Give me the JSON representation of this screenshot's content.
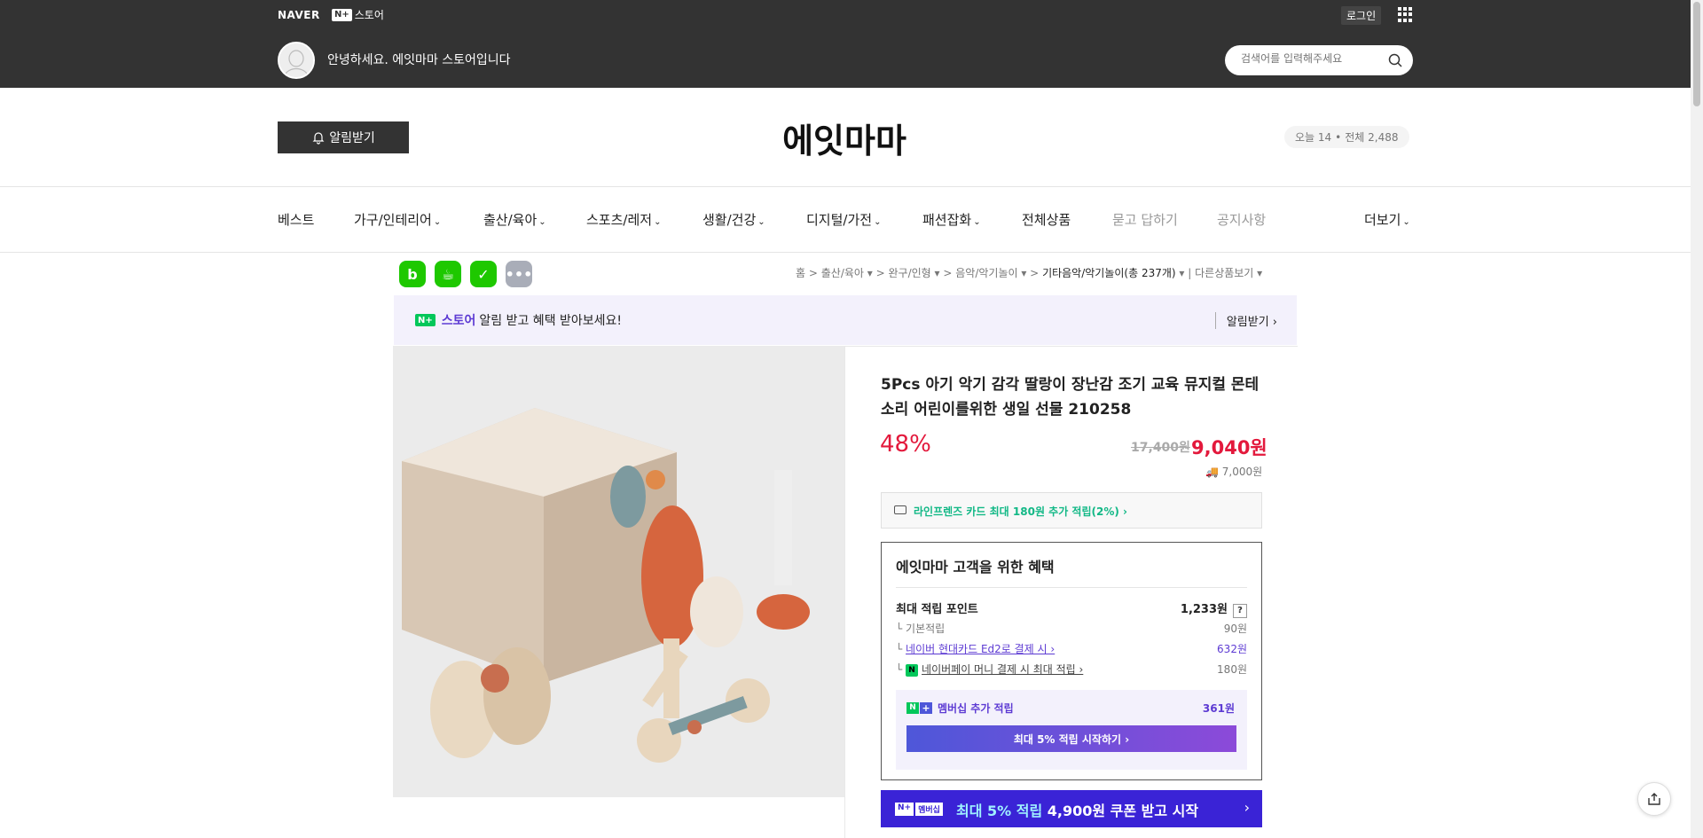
{
  "topbar": {
    "naver": "NAVER",
    "nplus_box": "N+",
    "nplus_store": "스토어",
    "login": "로그인",
    "greeting": "안녕하세요. 에잇마마 스토어입니다",
    "search_placeholder": "검색어를 입력해주세요"
  },
  "store": {
    "alert_label": "알림받기",
    "title": "에잇마마",
    "visit_today": "오늘 14",
    "visit_dot": "•",
    "visit_total": "전체 2,488"
  },
  "nav": {
    "items": [
      {
        "label": "베스트"
      },
      {
        "label": "가구/인테리어"
      },
      {
        "label": "출산/육아"
      },
      {
        "label": "스포츠/레저"
      },
      {
        "label": "생활/건강"
      },
      {
        "label": "디지털/가전"
      },
      {
        "label": "패션잡화"
      },
      {
        "label": "전체상품"
      },
      {
        "label": "묻고 답하기"
      },
      {
        "label": "공지사항"
      },
      {
        "label": "더보기"
      }
    ]
  },
  "breadcrumb": {
    "home": "홈",
    "c1": "출산/육아",
    "c2": "완구/인형",
    "c3": "음악/악기놀이",
    "c4": "기타음악/악기놀이(총 237개)",
    "other": "다른상품보기"
  },
  "banner": {
    "n_badge": "N+",
    "store": "스토어",
    "text": "알림 받고 혜택 받아보세요!",
    "right": "알림받기 ›"
  },
  "product": {
    "title": "5Pcs 아기 악기 감각 딸랑이 장난감 조기 교육 뮤지컬 몬테소리 어린이를위한 생일 선물 210258",
    "discount": "48%",
    "original_price": "17,400원",
    "price": "9,040원",
    "shipping": "7,000원",
    "card_promo": "라인프렌즈 카드 최대 180원 추가 적립(2%) ›"
  },
  "benefit": {
    "title": "에잇마마 고객을 위한 혜택",
    "max_point_label": "최대 적립 포인트",
    "max_point_value": "1,233원",
    "qmark": "?",
    "basic_label": "기본적립",
    "basic_value": "90원",
    "card_label": "네이버 현대카드 Ed2로 결제 시 ›",
    "card_value": "632원",
    "npay_badge": "N",
    "npay_label": "네이버페이 머니 결제 시 최대 적립 ›",
    "npay_value": "180원",
    "member_n": "N",
    "member_plus": "+",
    "member_label": "멤버십 추가 적립",
    "member_value": "361원",
    "member_button": "최대 5% 적립 시작하기 ›"
  },
  "coupon": {
    "badge_n": "N+",
    "badge_text": "멤버십",
    "text_hl": "최대 5% 적립",
    "text": " 4,900원 쿠폰 받고 시작",
    "arrow": "›"
  },
  "colors": {
    "topbar_bg": "#333333",
    "sale_red": "#e3193c",
    "naver_green": "#03c75a",
    "membership_purple": "#5d3bd3"
  }
}
